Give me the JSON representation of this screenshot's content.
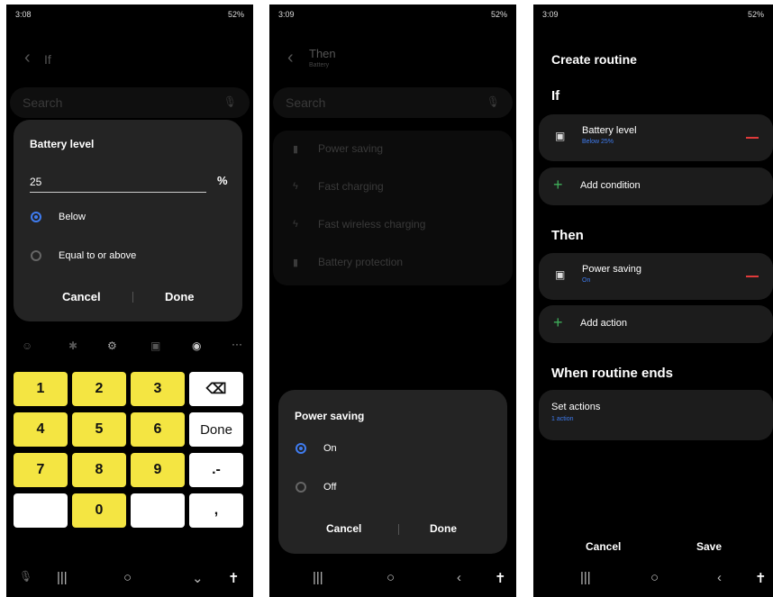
{
  "screen1": {
    "status_time": "3:08",
    "status_right": "52%",
    "back_icon": "‹",
    "page_title": "If",
    "search_placeholder": "Search",
    "dialog_title": "Battery level",
    "input_value": "25",
    "unit": "%",
    "option_below": "Below",
    "option_equal_above": "Equal to or above",
    "cancel_label": "Cancel",
    "done_label": "Done",
    "keypad": {
      "keys": [
        "1",
        "2",
        "3",
        "4",
        "5",
        "6",
        "7",
        "8",
        "9",
        "0"
      ],
      "done_key": "Done",
      "dot_dash_key": ".-",
      "comma_key": ","
    }
  },
  "screen2": {
    "status_time": "3:09",
    "status_right": "52%",
    "page_title": "Then",
    "page_subtitle": "Battery",
    "search_placeholder": "Search",
    "items": [
      "Power saving",
      "Fast charging",
      "Fast wireless charging",
      "Battery protection"
    ],
    "dialog_title": "Power saving",
    "option_on": "On",
    "option_off": "Off",
    "cancel_label": "Cancel",
    "done_label": "Done"
  },
  "screen3": {
    "status_time": "3:09",
    "status_right": "52%",
    "page_title": "Create routine",
    "if_heading": "If",
    "condition_title": "Battery level",
    "condition_sub": "Below 25%",
    "add_condition": "Add condition",
    "then_heading": "Then",
    "action_title": "Power saving",
    "action_sub": "On",
    "add_action": "Add action",
    "ends_heading": "When routine ends",
    "set_actions_title": "Set actions",
    "set_actions_sub": "1 action",
    "cancel_label": "Cancel",
    "save_label": "Save"
  },
  "colors": {
    "accent": "#3f7cf0",
    "key_yellow": "#f4e542",
    "danger": "#e03a3a",
    "dialog_bg": "#242424",
    "card_bg": "#1c1c1c"
  }
}
